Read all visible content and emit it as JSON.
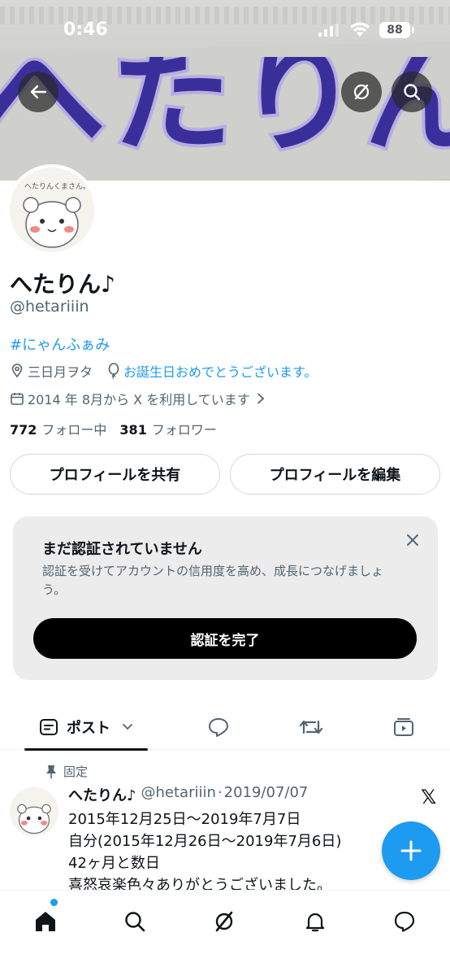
{
  "status_bar": {
    "time": "0:46",
    "battery": "88"
  },
  "banner": {
    "art_text": "へたりん"
  },
  "avatar": {
    "caption": "へたりんくまさん。"
  },
  "profile": {
    "name": "へたりん♪",
    "handle": "@hetariiin",
    "hashtag": "#にゃんふぁみ",
    "location": "三日月ヲタ",
    "birthday": "お誕生日おめでとうございます。",
    "joined": "2014 年 8月から X を利用しています",
    "following_count": "772",
    "following_label": "フォロー中",
    "followers_count": "381",
    "followers_label": "フォロワー"
  },
  "buttons": {
    "share": "プロフィールを共有",
    "edit": "プロフィールを編集"
  },
  "verification": {
    "title": "まだ認証されていません",
    "description": "認証を受けてアカウントの信用度を高め、成長につなげましょう。",
    "cta": "認証を完了"
  },
  "tabs": {
    "posts": "ポスト"
  },
  "pinned_post": {
    "pinned_label": "固定",
    "author_name": "へたりん♪",
    "author_handle": "@hetariiin",
    "separator": "·",
    "date": "2019/07/07",
    "lines": [
      "2015年12月25日～2019年7月7日",
      "自分(2015年12月26日～2019年7月6日)",
      "42ヶ月と数日",
      "喜怒哀楽色々ありがとうございました。"
    ]
  },
  "colors": {
    "accent": "#1d9bf0",
    "text": "#0f1419",
    "secondary": "#536471",
    "banner_ink": "#3a2f9a"
  }
}
